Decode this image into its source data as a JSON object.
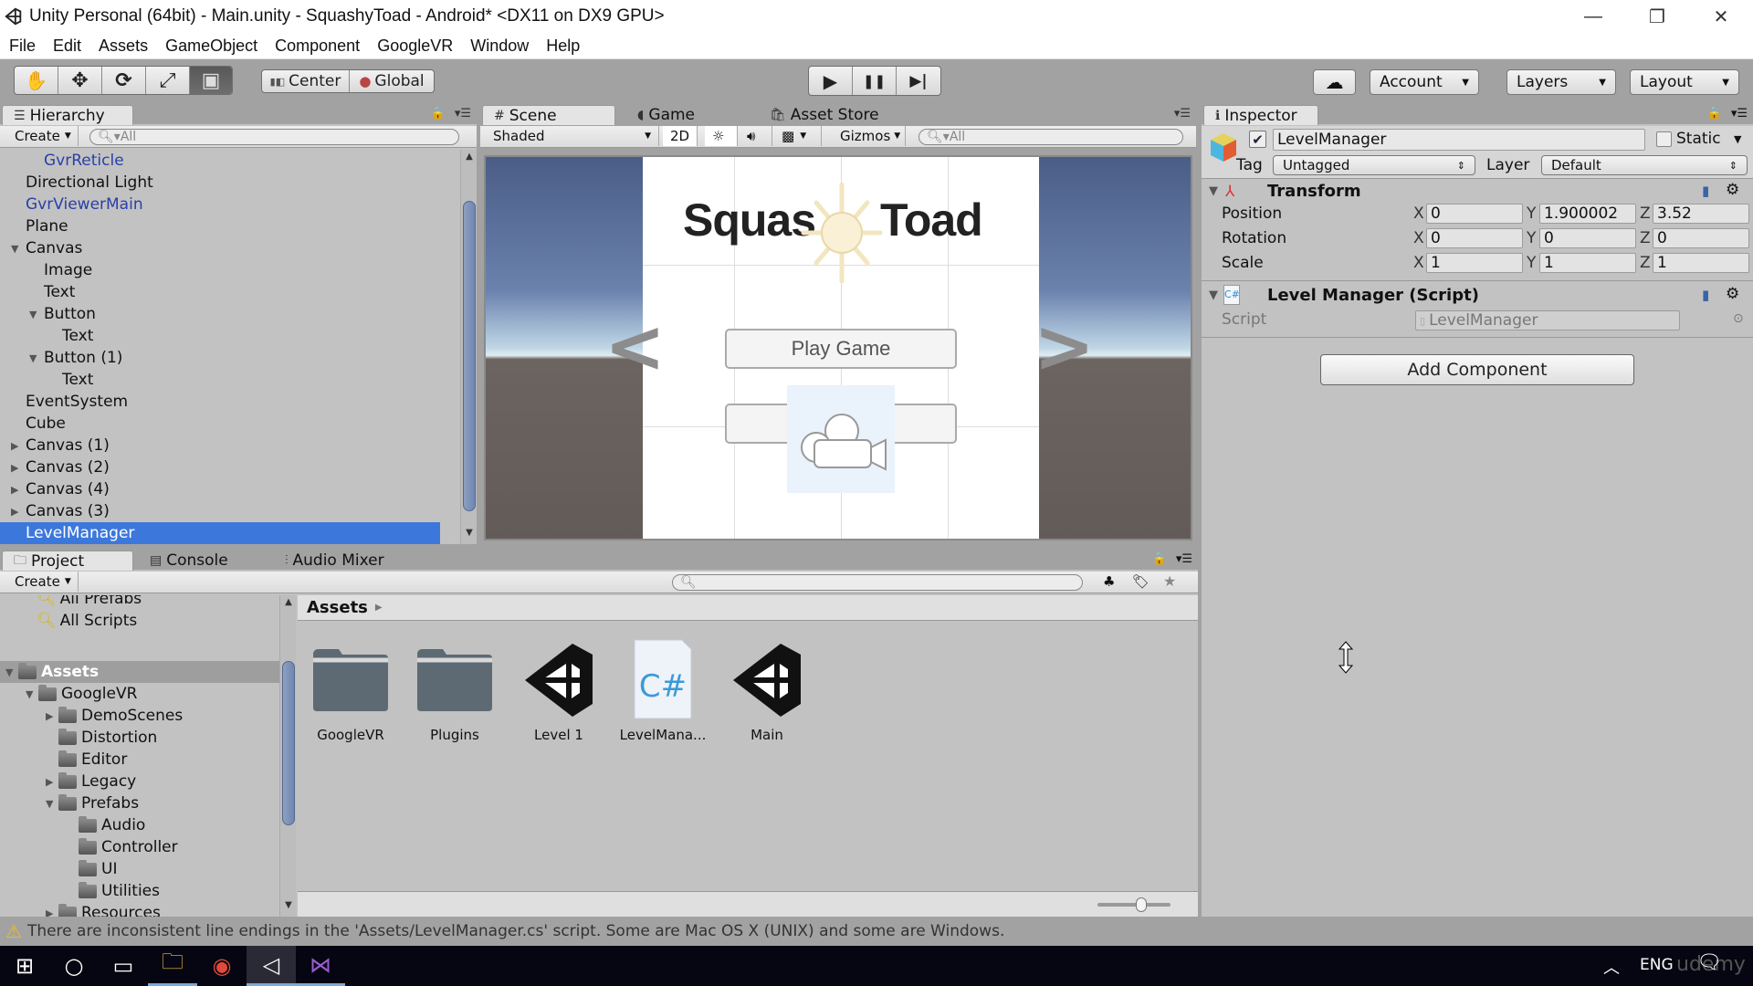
{
  "window": {
    "title": "Unity Personal (64bit) - Main.unity - SquashyToad - Android* <DX11 on DX9 GPU>",
    "controls": {
      "minimize": "—",
      "restore": "❐",
      "close": "✕"
    }
  },
  "menu": [
    "File",
    "Edit",
    "Assets",
    "GameObject",
    "Component",
    "GoogleVR",
    "Window",
    "Help"
  ],
  "toolbar": {
    "tools": [
      {
        "name": "hand-tool",
        "icon": "✋"
      },
      {
        "name": "move-tool",
        "icon": "✥"
      },
      {
        "name": "rotate-tool",
        "icon": "⟳"
      },
      {
        "name": "scale-tool",
        "icon": "⤢"
      },
      {
        "name": "rect-tool",
        "icon": "▣"
      }
    ],
    "pivot": "Center",
    "space": "Global",
    "play": "▶",
    "pause": "❚❚",
    "step": "▶|",
    "cloud": "☁",
    "account": "Account",
    "layers": "Layers",
    "layout": "Layout"
  },
  "hierarchy": {
    "tab": "Hierarchy",
    "create": "Create",
    "search_placeholder": "All",
    "items": [
      {
        "label": "GvrReticle",
        "depth": 2,
        "arrow": "",
        "color": "blue"
      },
      {
        "label": "Directional Light",
        "depth": 1,
        "arrow": "",
        "color": "normal"
      },
      {
        "label": "GvrViewerMain",
        "depth": 1,
        "arrow": "",
        "color": "blue"
      },
      {
        "label": "Plane",
        "depth": 1,
        "arrow": "",
        "color": "normal"
      },
      {
        "label": "Canvas",
        "depth": 1,
        "arrow": "▼",
        "color": "normal"
      },
      {
        "label": "Image",
        "depth": 2,
        "arrow": "",
        "color": "normal"
      },
      {
        "label": "Text",
        "depth": 2,
        "arrow": "",
        "color": "normal"
      },
      {
        "label": "Button",
        "depth": 2,
        "arrow": "▼",
        "color": "normal"
      },
      {
        "label": "Text",
        "depth": 3,
        "arrow": "",
        "color": "normal"
      },
      {
        "label": "Button (1)",
        "depth": 2,
        "arrow": "▼",
        "color": "normal"
      },
      {
        "label": "Text",
        "depth": 3,
        "arrow": "",
        "color": "normal"
      },
      {
        "label": "EventSystem",
        "depth": 1,
        "arrow": "",
        "color": "normal"
      },
      {
        "label": "Cube",
        "depth": 1,
        "arrow": "",
        "color": "normal"
      },
      {
        "label": "Canvas (1)",
        "depth": 1,
        "arrow": "▶",
        "color": "normal"
      },
      {
        "label": "Canvas (2)",
        "depth": 1,
        "arrow": "▶",
        "color": "normal"
      },
      {
        "label": "Canvas (4)",
        "depth": 1,
        "arrow": "▶",
        "color": "normal"
      },
      {
        "label": "Canvas (3)",
        "depth": 1,
        "arrow": "▶",
        "color": "normal"
      },
      {
        "label": "LevelManager",
        "depth": 1,
        "arrow": "",
        "color": "selected"
      }
    ]
  },
  "scene": {
    "tabs": [
      "Scene",
      "Game",
      "Asset Store"
    ],
    "shading": "Shaded",
    "mode2d": "2D",
    "gizmos": "Gizmos",
    "search_placeholder": "All",
    "game_title_left": "Squas",
    "game_title_right": "Toad",
    "play_button": "Play Game",
    "nav_left": "<",
    "nav_right": ">"
  },
  "inspector": {
    "tab": "Inspector",
    "object_name": "LevelManager",
    "active": true,
    "static_label": "Static",
    "tag_label": "Tag",
    "tag_value": "Untagged",
    "layer_label": "Layer",
    "layer_value": "Default",
    "transform": {
      "title": "Transform",
      "rows": [
        {
          "label": "Position",
          "x": "0",
          "y": "1.900002",
          "z": "3.52"
        },
        {
          "label": "Rotation",
          "x": "0",
          "y": "0",
          "z": "0"
        },
        {
          "label": "Scale",
          "x": "1",
          "y": "1",
          "z": "1"
        }
      ]
    },
    "script_component": {
      "title": "Level Manager (Script)",
      "script_label": "Script",
      "script_value": "LevelManager"
    },
    "add_component": "Add Component"
  },
  "project": {
    "tabs": [
      "Project",
      "Console",
      "Audio Mixer"
    ],
    "create": "Create",
    "favorites": [
      "All Prefabs",
      "All Scripts"
    ],
    "tree": [
      {
        "label": "Assets",
        "depth": 0,
        "arrow": "▼",
        "header": true
      },
      {
        "label": "GoogleVR",
        "depth": 1,
        "arrow": "▼"
      },
      {
        "label": "DemoScenes",
        "depth": 2,
        "arrow": "▶"
      },
      {
        "label": "Distortion",
        "depth": 2,
        "arrow": ""
      },
      {
        "label": "Editor",
        "depth": 2,
        "arrow": ""
      },
      {
        "label": "Legacy",
        "depth": 2,
        "arrow": "▶"
      },
      {
        "label": "Prefabs",
        "depth": 2,
        "arrow": "▼"
      },
      {
        "label": "Audio",
        "depth": 3,
        "arrow": ""
      },
      {
        "label": "Controller",
        "depth": 3,
        "arrow": ""
      },
      {
        "label": "UI",
        "depth": 3,
        "arrow": ""
      },
      {
        "label": "Utilities",
        "depth": 3,
        "arrow": ""
      },
      {
        "label": "Resources",
        "depth": 2,
        "arrow": "▶"
      }
    ],
    "breadcrumb": "Assets",
    "assets": [
      {
        "label": "GoogleVR",
        "type": "folder"
      },
      {
        "label": "Plugins",
        "type": "folder"
      },
      {
        "label": "Level 1",
        "type": "scene"
      },
      {
        "label": "LevelMana...",
        "type": "script"
      },
      {
        "label": "Main",
        "type": "scene"
      }
    ]
  },
  "status": {
    "warning": "There are inconsistent line endings in the 'Assets/LevelManager.cs' script. Some are Mac OS X (UNIX) and some are Windows."
  },
  "taskbar": {
    "lang": "ENG",
    "watermark": "udemy"
  }
}
